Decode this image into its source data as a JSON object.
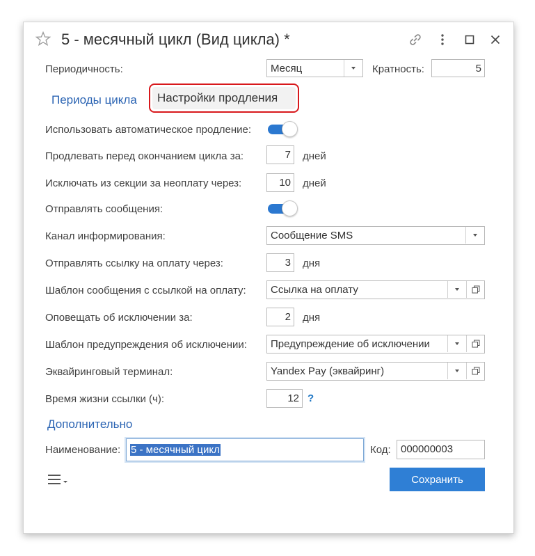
{
  "window": {
    "title": "5 - месячный цикл (Вид цикла) *"
  },
  "header_icons": [
    "star-icon",
    "link-icon",
    "more-vertical-icon",
    "maximize-icon",
    "close-icon"
  ],
  "periodicity": {
    "label": "Периодичность:",
    "value": "Месяц",
    "multiplicity_label": "Кратность:",
    "multiplicity_value": "5"
  },
  "tabs": [
    {
      "label": "Периоды цикла",
      "active": false
    },
    {
      "label": "Настройки продления",
      "active": true
    }
  ],
  "settings": {
    "auto_renew": {
      "label": "Использовать автоматическое продление:",
      "on": true
    },
    "renew_before": {
      "label": "Продлевать перед окончанием цикла за:",
      "value": "7",
      "unit": "дней"
    },
    "exclude_after": {
      "label": "Исключать из секции за неоплату через:",
      "value": "10",
      "unit": "дней"
    },
    "send_messages": {
      "label": "Отправлять сообщения:",
      "on": true
    },
    "channel": {
      "label": "Канал информирования:",
      "value": "Сообщение SMS"
    },
    "send_link_after": {
      "label": "Отправлять ссылку на оплату через:",
      "value": "3",
      "unit": "дня"
    },
    "link_template": {
      "label": "Шаблон сообщения с ссылкой на оплату:",
      "value": "Ссылка на оплату"
    },
    "notify_exclusion": {
      "label": "Оповещать об исключении за:",
      "value": "2",
      "unit": "дня"
    },
    "warning_template": {
      "label": "Шаблон предупреждения об исключении:",
      "value": "Предупреждение об исключении"
    },
    "terminal": {
      "label": "Эквайринговый терминал:",
      "value": "Yandex Pay (эквайринг)"
    },
    "link_lifetime": {
      "label": "Время жизни ссылки (ч):",
      "value": "12",
      "help": "?"
    }
  },
  "additional": {
    "title": "Дополнительно"
  },
  "name": {
    "label": "Наименование:",
    "value": "5 - месячный цикл"
  },
  "code": {
    "label": "Код:",
    "value": "000000003"
  },
  "footer": {
    "save_label": "Сохранить"
  },
  "colors": {
    "accent": "#2f7fd5",
    "link": "#2b64b3",
    "toggle": "#2b78d0",
    "highlight": "#d8181c"
  }
}
